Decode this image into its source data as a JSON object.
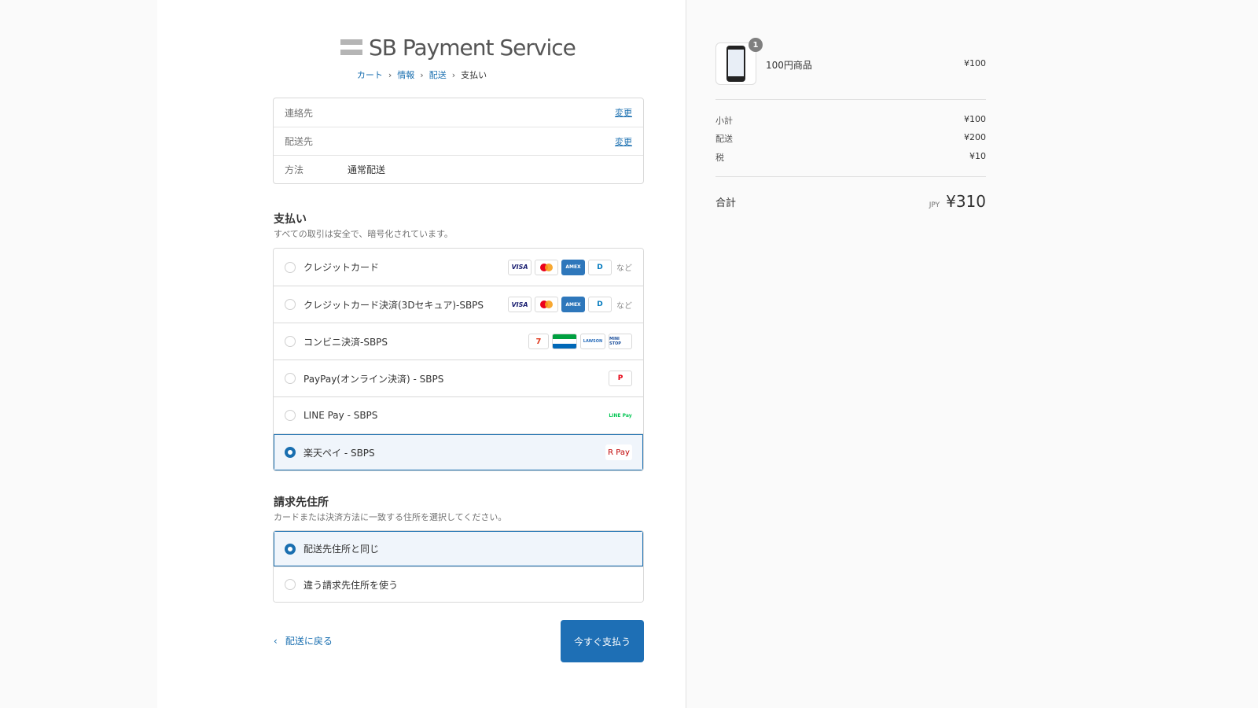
{
  "brand": {
    "name": "SB Payment Service"
  },
  "breadcrumb": [
    "カート",
    "情報",
    "配送",
    "支払い"
  ],
  "review": {
    "rows": [
      {
        "label": "連絡先",
        "value": "",
        "link": "変更"
      },
      {
        "label": "配送先",
        "value": "",
        "link": "変更"
      },
      {
        "label": "方法",
        "value": "通常配送",
        "link": ""
      }
    ]
  },
  "payment": {
    "title": "支払い",
    "subtitle": "すべての取引は安全で、暗号化されています。",
    "methods": [
      {
        "label": "クレジットカード",
        "selected": false
      },
      {
        "label": "クレジットカード決済(3Dセキュア)-SBPS",
        "selected": false
      },
      {
        "label": "コンビニ決済-SBPS",
        "selected": false
      },
      {
        "label": "PayPay(オンライン決済) - SBPS",
        "selected": false
      },
      {
        "label": "LINE Pay - SBPS",
        "selected": false
      },
      {
        "label": "楽天ペイ - SBPS",
        "selected": true
      }
    ],
    "more_label": "など",
    "badges": {
      "visa": "VISA",
      "amex": "AMEX",
      "diners": "D",
      "seven": "7",
      "familymart": "FamilyMart",
      "lawson": "LAWSON",
      "ministop": "MINI STOP",
      "paypay": "P",
      "linepay": "LINE Pay",
      "rpay": "R Pay"
    }
  },
  "billing": {
    "title": "請求先住所",
    "subtitle": "カードまたは決済方法に一致する住所を選択してください。",
    "options": [
      {
        "label": "配送先住所と同じ",
        "selected": true
      },
      {
        "label": "違う請求先住所を使う",
        "selected": false
      }
    ]
  },
  "actions": {
    "back_label": "配送に戻る",
    "pay_label": "今すぐ支払う"
  },
  "summary": {
    "product": {
      "name": "100円商品",
      "price": "¥100",
      "quantity": "1"
    },
    "subtotal_label": "小計",
    "subtotal": "¥100",
    "shipping_label": "配送",
    "shipping": "¥200",
    "tax_label": "税",
    "tax": "¥10",
    "total_label": "合計",
    "currency": "JPY",
    "total": "¥310"
  },
  "colors": {
    "accent": "#1e6fb5",
    "link": "#1a6fb0",
    "selected_bg": "#f0f5fb"
  }
}
